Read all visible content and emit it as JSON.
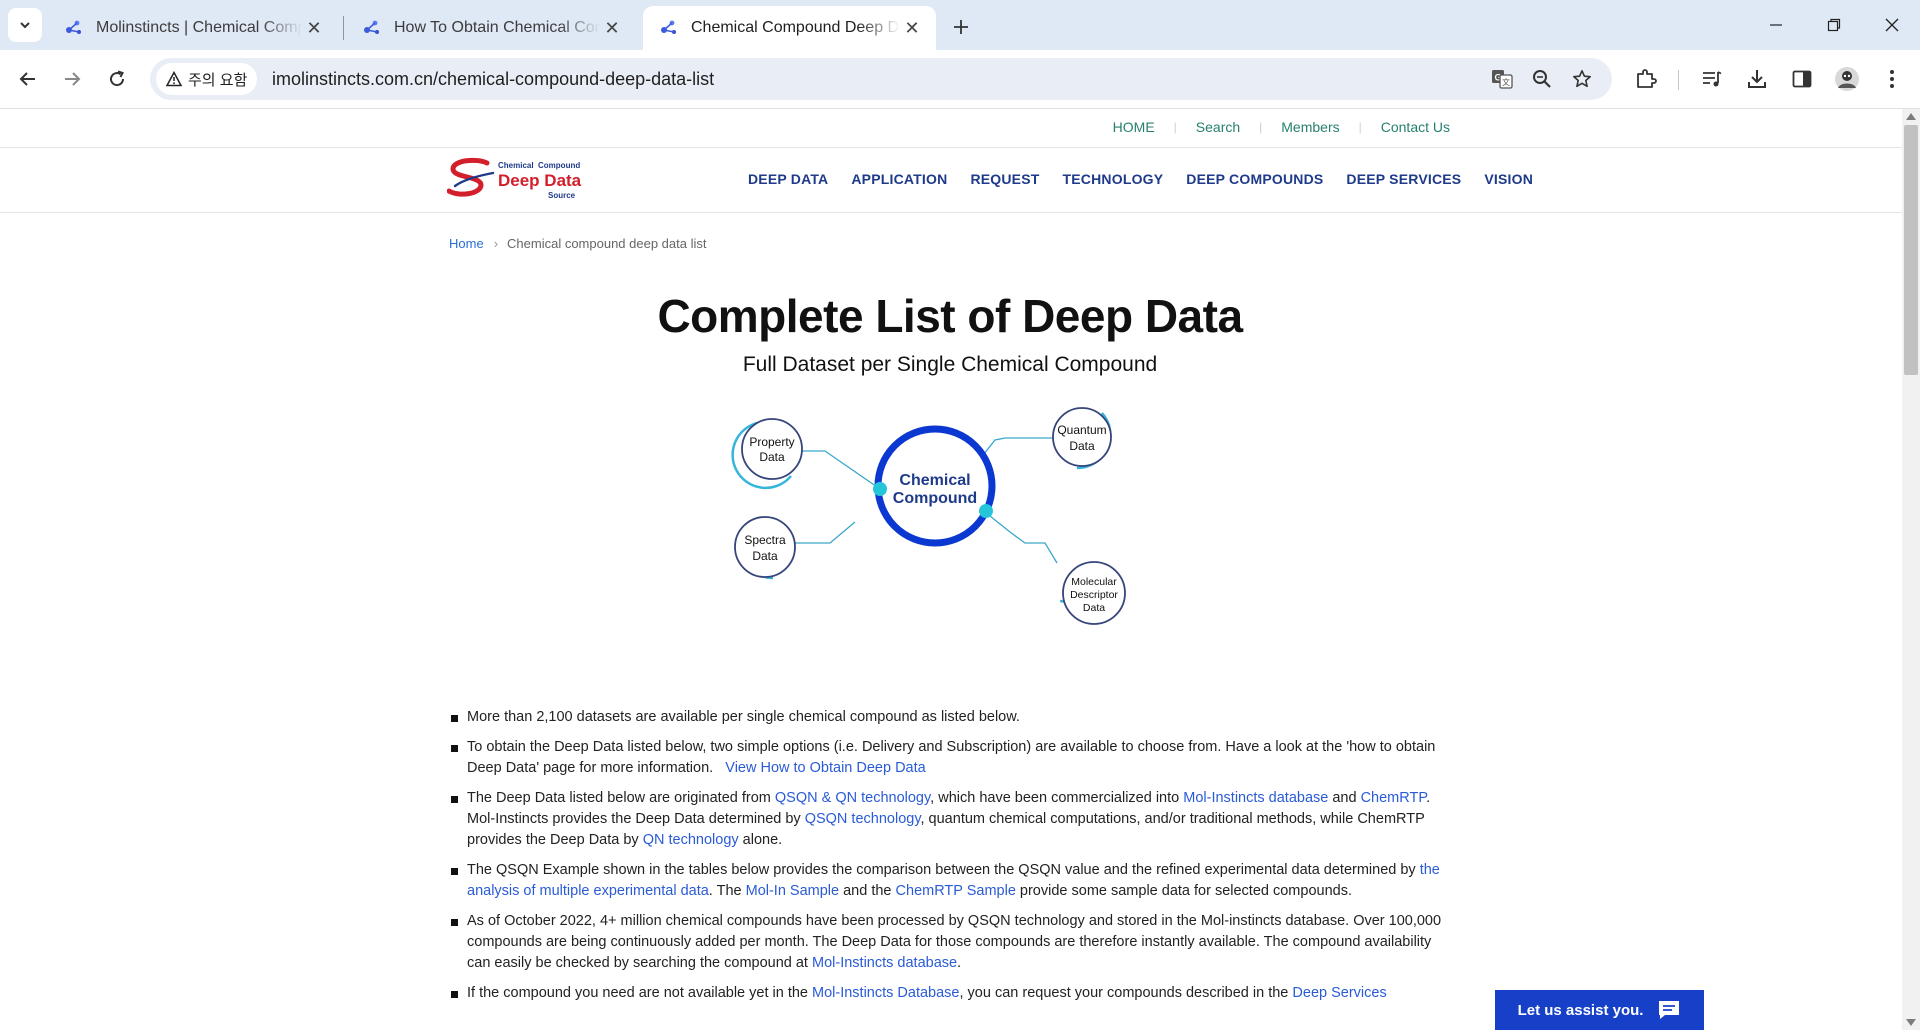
{
  "browser": {
    "tabs": [
      {
        "title": "Molinstincts | Chemical Compo",
        "active": false
      },
      {
        "title": "How To Obtain Chemical Com",
        "active": false
      },
      {
        "title": "Chemical Compound Deep Da",
        "active": true
      }
    ],
    "security_chip": "주의 요함",
    "url": "imolinstincts.com.cn/chemical-compound-deep-data-list"
  },
  "site": {
    "util_nav": [
      "HOME",
      "Search",
      "Members",
      "Contact Us"
    ],
    "logo": {
      "line1": "Chemical  Compound",
      "line2": "Deep Data",
      "line3": "Source"
    },
    "main_nav": [
      "DEEP DATA",
      "APPLICATION",
      "REQUEST",
      "TECHNOLOGY",
      "DEEP COMPOUNDS",
      "DEEP SERVICES",
      "VISION"
    ],
    "breadcrumb": {
      "home": "Home",
      "current": "Chemical compound deep data list"
    },
    "title": "Complete List of Deep Data",
    "subtitle": "Full Dataset per Single Chemical Compound",
    "diagram": {
      "center": [
        "Chemical",
        "Compound"
      ],
      "nodes": {
        "property": [
          "Property",
          "Data"
        ],
        "quantum": [
          "Quantum",
          "Data"
        ],
        "spectra": [
          "Spectra",
          "Data"
        ],
        "descriptor": [
          "Molecular",
          "Descriptor",
          "Data"
        ]
      }
    },
    "bullets": {
      "b1": "More than 2,100 datasets are available per single chemical compound as listed below.",
      "b2": {
        "t1": "To obtain the Deep Data listed below, two simple options (i.e. Delivery and Subscription) are available to choose from. Have a look at the 'how to obtain Deep Data' page for more information.",
        "link": "View How to Obtain Deep Data"
      },
      "b3": {
        "t1": "The Deep Data listed below are originated from ",
        "l1": "QSQN & QN technology",
        "t2": ", which have been commercialized into ",
        "l2": "Mol-Instincts database",
        "t3": " and ",
        "l3": "ChemRTP",
        "t4": ". Mol-Instincts provides the Deep Data determined by ",
        "l4": "QSQN technology",
        "t5": ", quantum chemical computations, and/or traditional methods, while ChemRTP provides the Deep Data by ",
        "l5": "QN technology",
        "t6": " alone."
      },
      "b4": {
        "t1": "The QSQN Example shown in the tables below provides the comparison between the QSQN value and the refined experimental data determined by ",
        "l1": "the analysis of multiple experimental data",
        "t2": ". The ",
        "l2": "Mol-In Sample",
        "t3": " and the ",
        "l3": "ChemRTP Sample",
        "t4": " provide some sample data for selected compounds."
      },
      "b5": {
        "t1": "As of October 2022, 4+ million chemical compounds have been processed by QSQN technology and stored in the Mol-instincts database. Over 100,000 compounds are being continuously added per month. The Deep Data for those compounds are therefore instantly available. The compound availability can easily be checked by searching the compound at ",
        "l1": "Mol-Instincts database",
        "t2": "."
      },
      "b6": {
        "t1": "If the compound you need are not available yet in the ",
        "l1": "Mol-Instincts Database",
        "t2": ", you can request your compounds described in the ",
        "l2": "Deep Services"
      }
    },
    "assist_button": "Let us assist you."
  },
  "colors": {
    "nav": "#1e3a8a",
    "util_link": "#27806f",
    "link": "#2a5bd7",
    "assist": "#1740c9",
    "logo_red": "#d21f2b"
  }
}
